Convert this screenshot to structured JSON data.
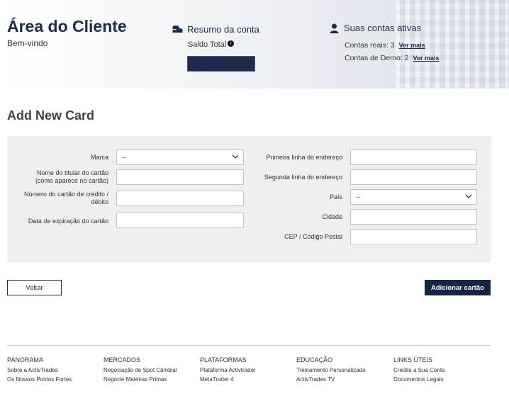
{
  "header": {
    "title": "Área do Cliente",
    "welcome": "Bem-vindo",
    "summary": {
      "heading": "Resumo da conta",
      "heading_icon": "coins-icon",
      "saldo_label": "Saldo Total",
      "info_glyph": "i"
    },
    "accounts": {
      "heading": "Suas contas ativas",
      "heading_icon": "user-icon",
      "real_text": "Contas reais: 3",
      "real_link": "Ver mais",
      "demo_text": "Contas de Demo: 2",
      "demo_link": "Ver mais"
    }
  },
  "section_title": "Add New Card",
  "form": {
    "left": {
      "brand_label": "Marca",
      "brand_value": "--",
      "holder_label_1": "Nome do titular do cartão",
      "holder_label_2": "(como aparece no cartão)",
      "number_label_1": "Número do cartão de crédito /",
      "number_label_2": "débito",
      "expiry_label": "Data de expiração do cartão"
    },
    "right": {
      "address1_label": "Primeira linha do endereço",
      "address2_label": "Segunda linha do endereço",
      "country_label": "País",
      "country_value": "--",
      "city_label": "Cidade",
      "zip_label": "CEP / Código Postal"
    }
  },
  "buttons": {
    "back": "Voltar",
    "add": "Adicionar cartão"
  },
  "footer": {
    "columns": [
      {
        "heading": "PANORAMA",
        "links": [
          "Sobre a ActivTrades",
          "Os Nossos Pontos Fortes"
        ]
      },
      {
        "heading": "MERCADOS",
        "links": [
          "Negociação de Spot Câmbial",
          "Negocie Matérias Primas"
        ]
      },
      {
        "heading": "PLATAFORMAS",
        "links": [
          "Plataforma Activtrader",
          "MetaTrader 4"
        ]
      },
      {
        "heading": "EDUCAÇÃO",
        "links": [
          "Treinamento Personalizado",
          "ActivTrades TV"
        ]
      },
      {
        "heading": "LINKS ÚTEIS",
        "links": [
          "Credite a Sua Conta",
          "Documentos Legais"
        ]
      }
    ]
  }
}
